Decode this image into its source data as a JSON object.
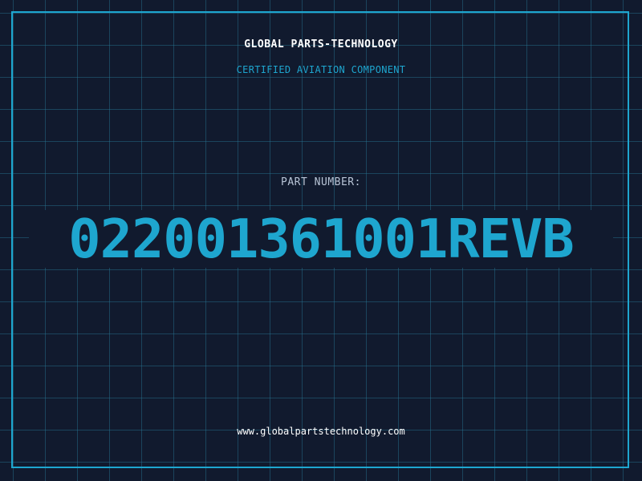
{
  "header": {
    "company": "GLOBAL PARTS-TECHNOLOGY",
    "tagline": "CERTIFIED AVIATION COMPONENT"
  },
  "part": {
    "label": "PART NUMBER:",
    "number": "022001361001REVB"
  },
  "footer": {
    "url": "www.globalpartstechnology.com"
  },
  "colors": {
    "background": "#111a2e",
    "accent": "#1ea6cf",
    "grid": "#28789a",
    "label_text": "#b8c4d6",
    "title_text": "#ffffff"
  }
}
